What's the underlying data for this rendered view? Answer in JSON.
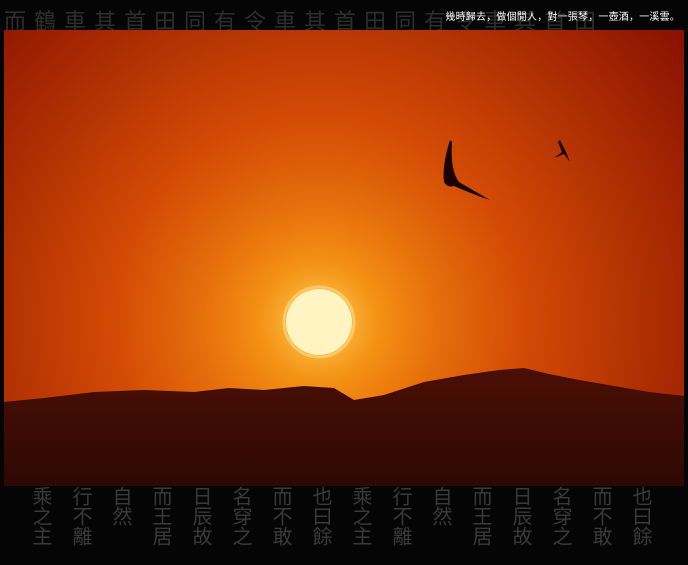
{
  "caption": "幾時歸去，做個閒人，對一張琴，一壺酒，一溪雲。",
  "background": {
    "top_calligraphy": "而鶴車其首田同有令車其首田同有令車其首田",
    "bottom_columns": [
      "乘之主",
      "行不離",
      "自然",
      "而王居",
      "日辰故",
      "名穿之",
      "而不敢",
      "也曰餘",
      "乘之主",
      "行不離",
      "自然",
      "而王居",
      "日辰故",
      "名穿之",
      "而不敢",
      "也曰餘"
    ]
  },
  "colors": {
    "sky_top": "#8a1200",
    "sky_mid": "#d24a05",
    "sun_glow": "#f6a21a",
    "sun_core": "#fff3b8",
    "mountains": "#3e0c04",
    "frame": "#050505"
  }
}
